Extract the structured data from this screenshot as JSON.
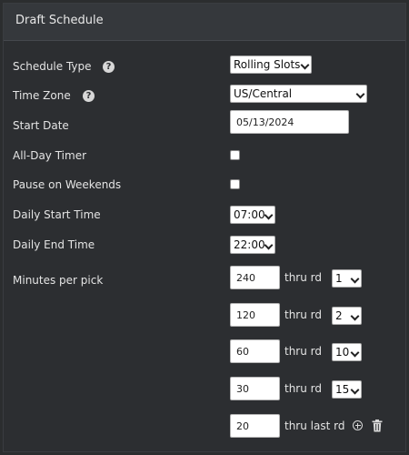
{
  "panel": {
    "title": "Draft Schedule"
  },
  "schedule_type": {
    "label": "Schedule Type",
    "help": "?",
    "value": "Rolling Slots"
  },
  "time_zone": {
    "label": "Time Zone",
    "help": "?",
    "value": "US/Central"
  },
  "start_date": {
    "label": "Start Date",
    "value": "05/13/2024"
  },
  "all_day_timer": {
    "label": "All-Day Timer",
    "checked": false
  },
  "pause_on_weekends": {
    "label": "Pause on Weekends",
    "checked": false
  },
  "daily_start_time": {
    "label": "Daily Start Time",
    "value": "07:00"
  },
  "daily_end_time": {
    "label": "Daily End Time",
    "value": "22:00"
  },
  "minutes_per_pick": {
    "label": "Minutes per pick",
    "thru_label": "thru rd",
    "last_label": "thru last rd",
    "rows": [
      {
        "minutes": "240",
        "round": "1"
      },
      {
        "minutes": "120",
        "round": "2"
      },
      {
        "minutes": "60",
        "round": "10"
      },
      {
        "minutes": "30",
        "round": "15"
      }
    ],
    "last_minutes": "20"
  },
  "colors": {
    "background": "#2b2d2f",
    "header": "#35383c",
    "text": "#e4e4e4"
  },
  "icons": {
    "help": "question-circle-icon",
    "add": "plus-circle-icon",
    "delete": "trash-icon",
    "dropdown": "chevron-down-icon"
  }
}
